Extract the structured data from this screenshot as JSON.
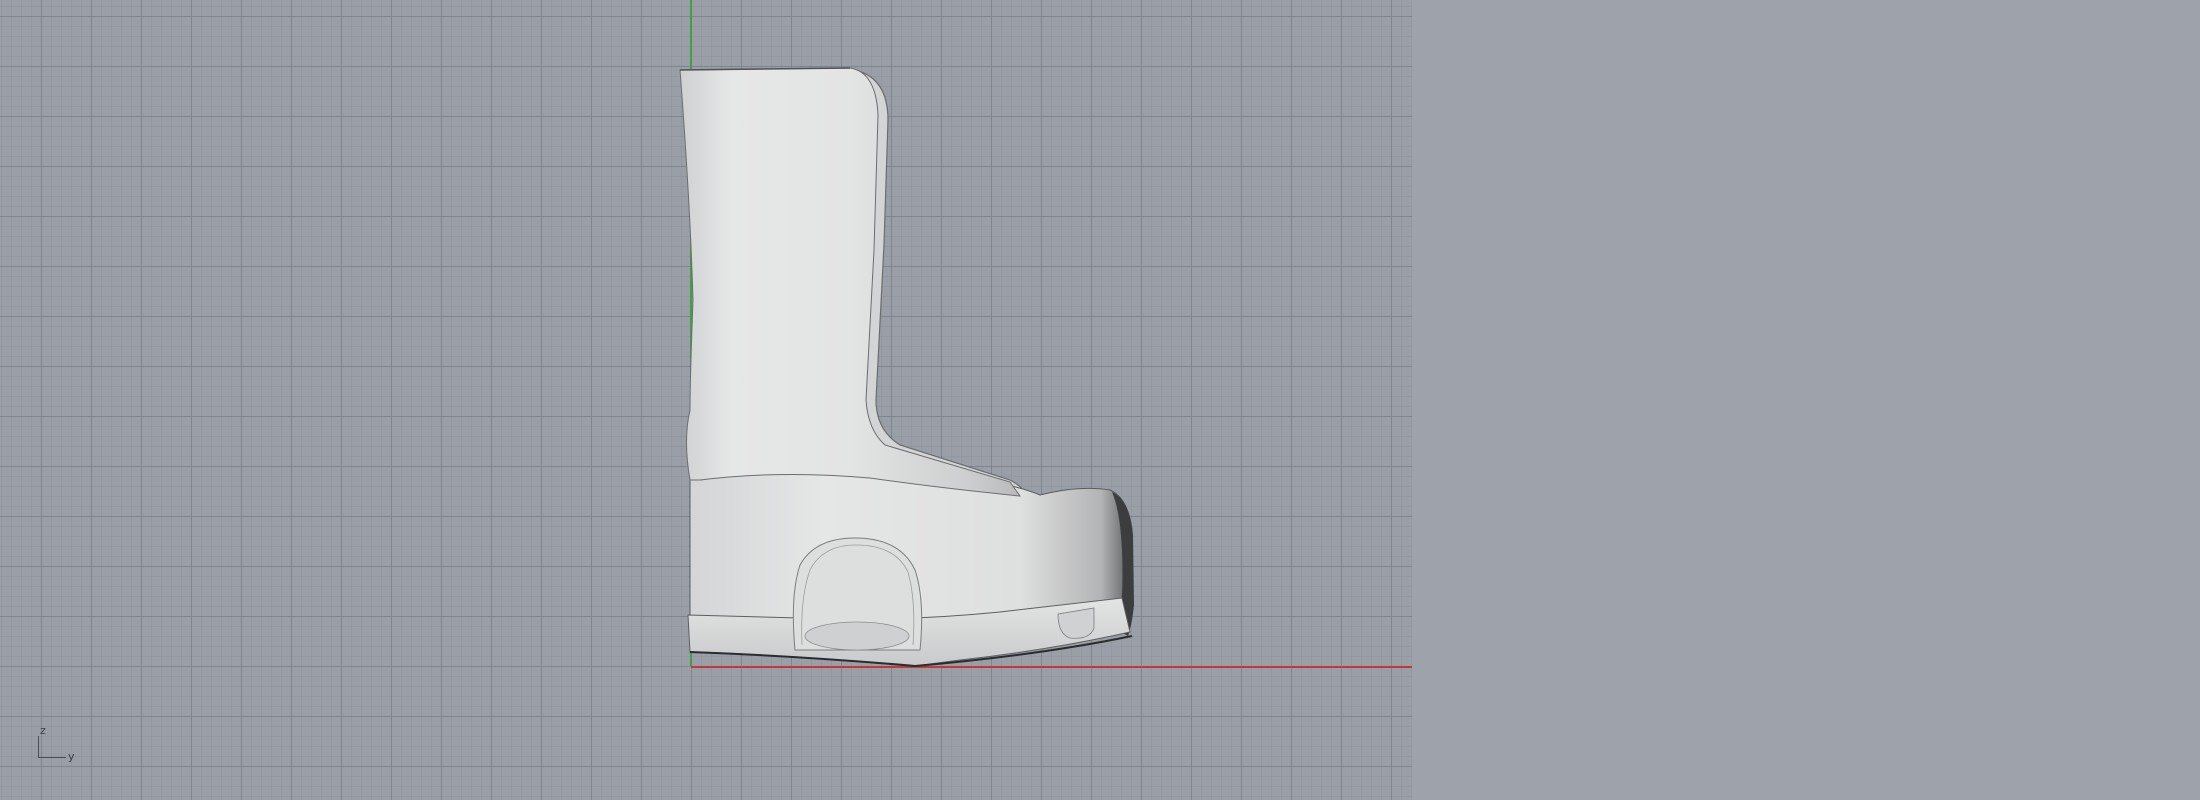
{
  "viewport": {
    "background_color": "#9a9fa7",
    "grid_minor_color": "#91969d",
    "grid_major_color": "#7d828a",
    "axis_colors": {
      "y_axis": "#3fa046",
      "x_axis": "#c0393b"
    }
  },
  "model": {
    "name": "boot",
    "surface_color": "#e2e3e3"
  },
  "gizmo": {
    "up_label": "z",
    "right_label": "y"
  },
  "side_panel": {
    "background_color": "#9ea3ab"
  }
}
